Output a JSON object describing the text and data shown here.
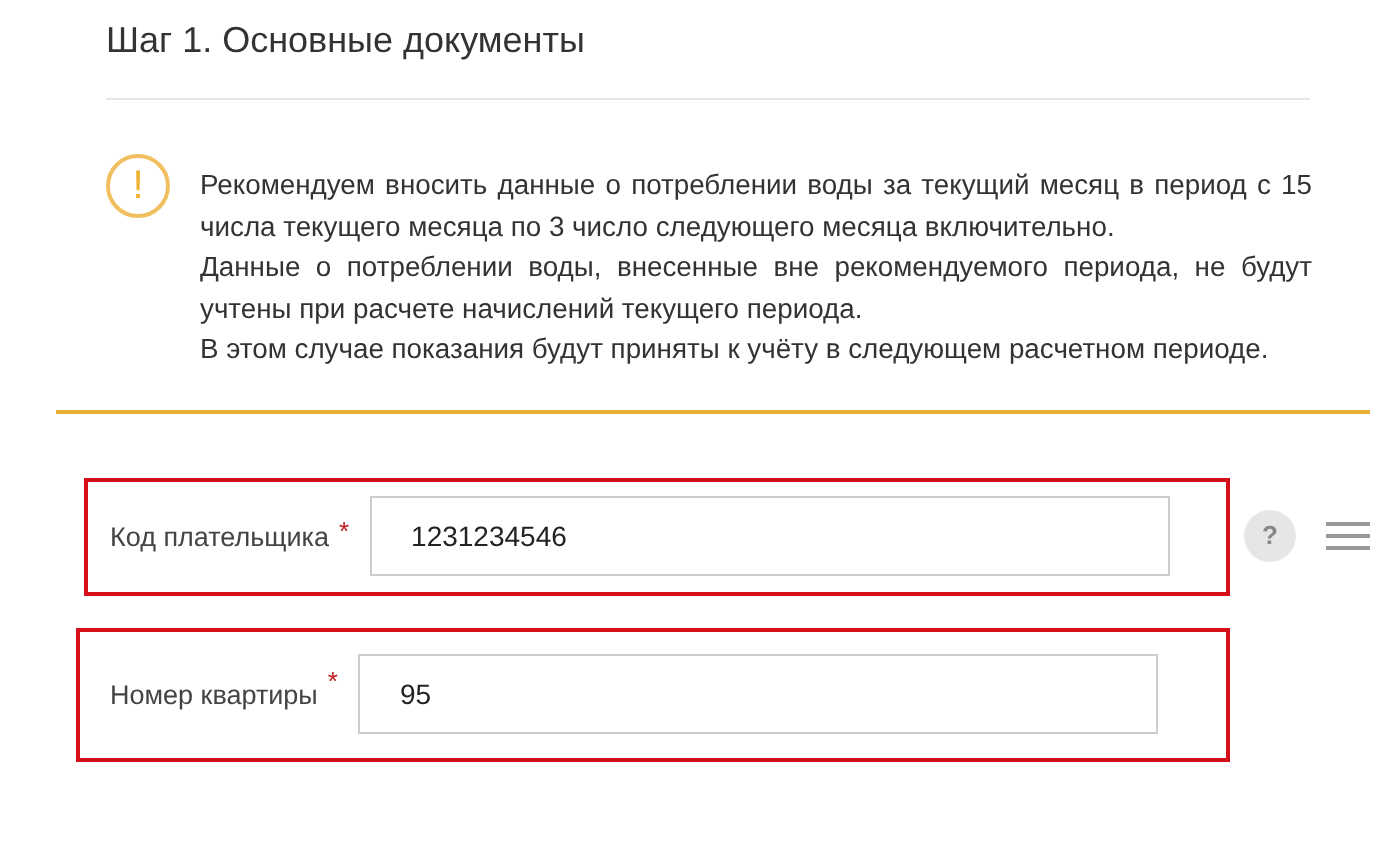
{
  "title": "Шаг 1. Основные документы",
  "notice": {
    "icon": "!",
    "paragraphs": [
      "Рекомендуем вносить данные о потреблении воды за текущий месяц в период с 15 числа текущего месяца по 3 число следующего месяца включительно.",
      "Данные о потреблении воды, внесенные вне рекомендуемого периода, не будут учтены при расчете начислений текущего периода.",
      "В этом случае показания будут приняты к учёту в следующем расчетном периоде."
    ]
  },
  "fields": [
    {
      "label": "Код плательщика",
      "required_mark": "*",
      "value": "1231234546",
      "highlighted": true,
      "help": "?",
      "menu": true
    },
    {
      "label": "Номер квартиры",
      "required_mark": "*",
      "value": "95",
      "highlighted": true
    }
  ]
}
